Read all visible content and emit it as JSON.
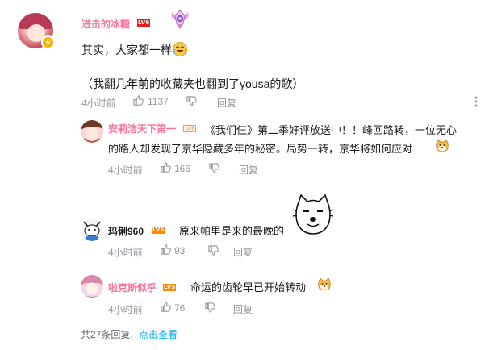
{
  "main_comment": {
    "username": "进击的冰糖",
    "level": "LV6",
    "line1": "其实，大家都一样",
    "line2": "（我翻几年前的收藏夹也翻到了yousa的歌）",
    "time": "4小时前",
    "likes": "1137",
    "reply_label": "回复"
  },
  "replies": [
    {
      "username": "安莉洁天下第一",
      "level": "LV6",
      "line1": "《我们仨》第二季好评放送中！！峰回路转，一位无心",
      "line2": "的路人却发现了京华隐藏多年的秘密。局势一转，京华将如何应对",
      "time": "4小时前",
      "likes": "166",
      "reply_label": "回复"
    },
    {
      "username": "玛俐960",
      "level": "LV5",
      "line1": "原来帕里是来的最晚的",
      "time": "4小时前",
      "likes": "93",
      "reply_label": "回复"
    },
    {
      "username": "啦克斯似乎",
      "level": "LV5",
      "line1": "命运的齿轮早已开始转动",
      "time": "4小时前",
      "likes": "76",
      "reply_label": "回复"
    }
  ],
  "footer": {
    "total_text": "共27条回复,",
    "link_text": "点击查看"
  },
  "colors": {
    "username": "#fb7299",
    "meta": "#9499a0",
    "link": "#00aeec",
    "lv6": "#e4201f",
    "lv5": "#ff8900"
  },
  "icons": [
    "lightning-icon",
    "medal-icon",
    "thumb-up-icon",
    "thumb-down-icon",
    "more-icon",
    "doge-emoji",
    "laugh-emoji",
    "doge-sketch-sticker"
  ]
}
